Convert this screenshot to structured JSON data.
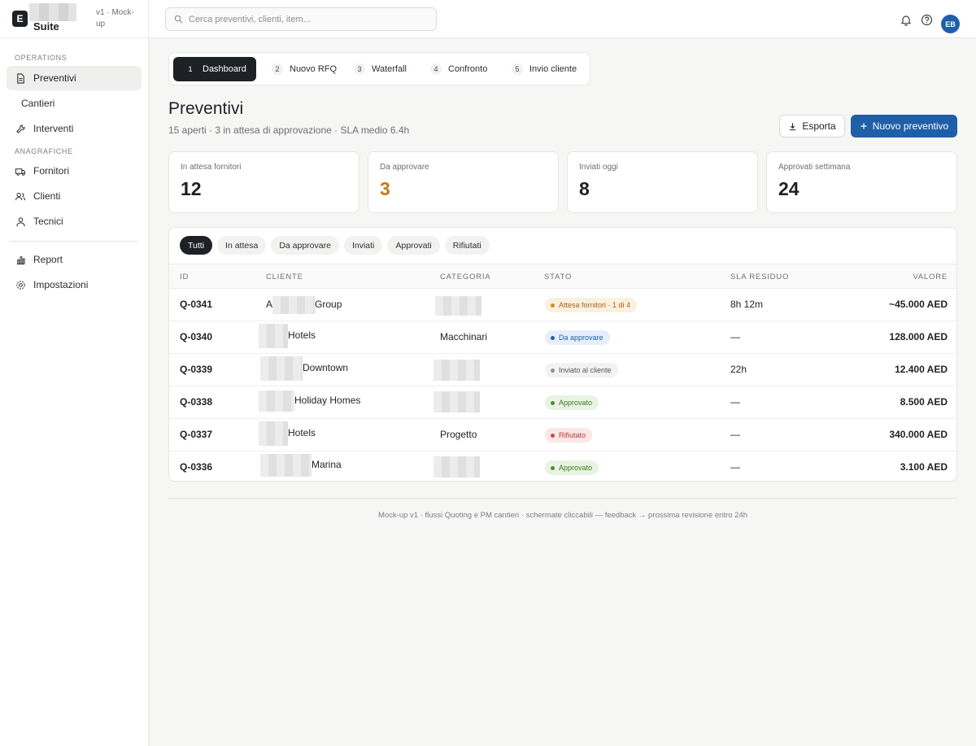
{
  "brand": {
    "logo_letter": "E",
    "name": "Suite",
    "version": "v1 · Mock-up"
  },
  "sidebar": {
    "section_operations": "OPERATIONS",
    "section_anagrafiche": "ANAGRAFICHE",
    "items": [
      {
        "label": "Preventivi",
        "icon": "file-icon",
        "active": true
      },
      {
        "label": "Cantieri",
        "icon": "",
        "active": false
      },
      {
        "label": "Interventi",
        "icon": "wrench-icon",
        "active": false
      },
      {
        "label": "Fornitori",
        "icon": "truck-icon",
        "active": false
      },
      {
        "label": "Clienti",
        "icon": "users-icon",
        "active": false
      },
      {
        "label": "Tecnici",
        "icon": "user-icon",
        "active": false
      },
      {
        "label": "Report",
        "icon": "bar-chart-icon",
        "active": false
      },
      {
        "label": "Impostazioni",
        "icon": "gear-icon",
        "active": false
      }
    ]
  },
  "topbar": {
    "search_placeholder": "Cerca preventivi, clienti, item...",
    "avatar_initials": "EB"
  },
  "steps": [
    {
      "num": "1",
      "label": "Dashboard",
      "active": true
    },
    {
      "num": "2",
      "label": "Nuovo RFQ",
      "active": false
    },
    {
      "num": "3",
      "label": "Waterfall",
      "active": false
    },
    {
      "num": "4",
      "label": "Confronto",
      "active": false
    },
    {
      "num": "5",
      "label": "Invio cliente",
      "active": false
    }
  ],
  "header": {
    "title": "Preventivi",
    "subtitle": "15 aperti · 3 in attesa di approvazione · SLA medio 6.4h",
    "export_label": "Esporta",
    "new_label": "Nuovo preventivo"
  },
  "kpis": [
    {
      "label": "In attesa fornitori",
      "value": "12"
    },
    {
      "label": "Da approvare",
      "value": "3"
    },
    {
      "label": "Inviati oggi",
      "value": "8"
    },
    {
      "label": "Approvati settimana",
      "value": "24"
    }
  ],
  "filters": [
    "Tutti",
    "In attesa",
    "Da approvare",
    "Inviati",
    "Approvati",
    "Rifiutati"
  ],
  "table": {
    "headers": {
      "id": "ID",
      "cliente": "CLIENTE",
      "categoria": "CATEGORIA",
      "stato": "STATO",
      "sla": "SLA RESIDUO",
      "valore": "VALORE"
    },
    "rows": [
      {
        "id": "Q-0341",
        "cliente_prefix": "A",
        "cliente": "Group",
        "categoria": "",
        "stato": "Attesa fornitori · 1 di 4",
        "stato_type": "wait",
        "sla": "8h 12m",
        "valore": "~45.000 AED"
      },
      {
        "id": "Q-0340",
        "cliente_prefix": "",
        "cliente": "Hotels",
        "categoria": "Macchinari",
        "stato": "Da approvare",
        "stato_type": "appr",
        "sla": "—",
        "valore": "128.000 AED"
      },
      {
        "id": "Q-0339",
        "cliente_prefix": "",
        "cliente": "Downtown",
        "categoria": "",
        "stato": "Inviato al cliente",
        "stato_type": "sent",
        "sla": "22h",
        "valore": "12.400 AED"
      },
      {
        "id": "Q-0338",
        "cliente_prefix": "",
        "cliente": "Holiday Homes",
        "categoria": "",
        "stato": "Approvato",
        "stato_type": "ok",
        "sla": "—",
        "valore": "8.500 AED"
      },
      {
        "id": "Q-0337",
        "cliente_prefix": "",
        "cliente": "Hotels",
        "categoria": "Progetto",
        "stato": "Rifiutato",
        "stato_type": "ko",
        "sla": "—",
        "valore": "340.000 AED"
      },
      {
        "id": "Q-0336",
        "cliente_prefix": "",
        "cliente": "Marina",
        "categoria": "",
        "stato": "Approvato",
        "stato_type": "ok",
        "sla": "—",
        "valore": "3.100 AED"
      }
    ]
  },
  "footer": "Mock-up v1 · flussi Quoting e PM cantieri · schermate cliccabili — feedback → prossima revisione entro 24h",
  "colors": {
    "accent": "#1f5fa8",
    "dark": "#1d2125",
    "warning": "#c47a1a"
  }
}
